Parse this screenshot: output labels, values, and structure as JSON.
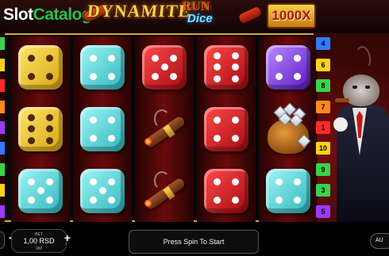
{
  "header": {
    "logo_slot": "Slot",
    "logo_catalog": "Catalog",
    "title_main": "DYNAMITE",
    "title_run": "RUN",
    "title_dice": "Dice",
    "multiplier": "1000X"
  },
  "reels": [
    [
      "yellow-die-4",
      "yellow-die-6",
      "cyan-die-5"
    ],
    [
      "cyan-die-4",
      "cyan-die-4",
      "cyan-die-5"
    ],
    [
      "red-die-5",
      "cigar",
      "cigar"
    ],
    [
      "red-die-6",
      "red-die-4",
      "red-die-4"
    ],
    [
      "purple-die-4",
      "money-bag",
      "cyan-die-4"
    ]
  ],
  "paylines_right": [
    {
      "label": "4",
      "color": "#2f7cff"
    },
    {
      "label": "6",
      "color": "#ffd21a"
    },
    {
      "label": "8",
      "color": "#39d24a"
    },
    {
      "label": "7",
      "color": "#ff8a1a"
    },
    {
      "label": "1",
      "color": "#ff2a2a"
    },
    {
      "label": "10",
      "color": "#ffd21a"
    },
    {
      "label": "9",
      "color": "#39d24a"
    },
    {
      "label": "3",
      "color": "#39d24a"
    },
    {
      "label": "5",
      "color": "#9a3bff"
    }
  ],
  "paylines_left": [
    {
      "color": "#39d24a"
    },
    {
      "color": "#ffd21a"
    },
    {
      "color": "#ff2a2a"
    },
    {
      "color": "#ff8a1a"
    },
    {
      "color": "#9a3bff"
    },
    {
      "color": "#2f7cff"
    },
    {
      "color": "#39d24a"
    },
    {
      "color": "#ffd21a"
    },
    {
      "color": "#9a3bff"
    }
  ],
  "controls": {
    "minus": "−",
    "plus": "+",
    "bet_label": "BET",
    "bet_value": "1,00 RSD",
    "bet_sub": "100",
    "message": "Press Spin To Start",
    "auto_label": "AU"
  }
}
